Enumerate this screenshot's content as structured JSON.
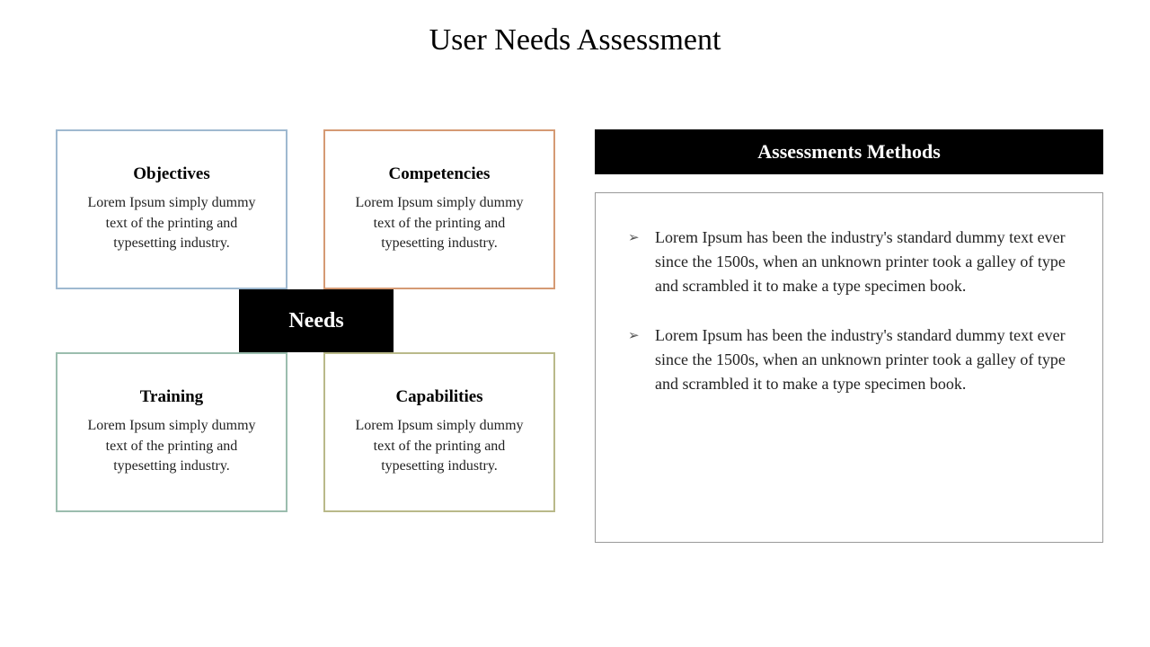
{
  "title": "User Needs Assessment",
  "center_label": "Needs",
  "boxes": {
    "objectives": {
      "title": "Objectives",
      "desc": "Lorem Ipsum simply dummy text of the printing and typesetting industry."
    },
    "competencies": {
      "title": "Competencies",
      "desc": "Lorem Ipsum simply dummy text of the printing and typesetting industry."
    },
    "training": {
      "title": "Training",
      "desc": "Lorem Ipsum simply dummy text of the printing and typesetting industry."
    },
    "capabilities": {
      "title": "Capabilities",
      "desc": "Lorem Ipsum simply dummy text of the printing and typesetting industry."
    }
  },
  "methods": {
    "header": "Assessments Methods",
    "items": [
      "Lorem Ipsum has been the industry's standard dummy text ever since the 1500s, when an unknown printer took a galley of type and scrambled it to make a type specimen book.",
      "Lorem Ipsum has been the industry's standard dummy text ever since the 1500s, when an unknown printer took a galley of type and scrambled it to make a type specimen book."
    ]
  }
}
